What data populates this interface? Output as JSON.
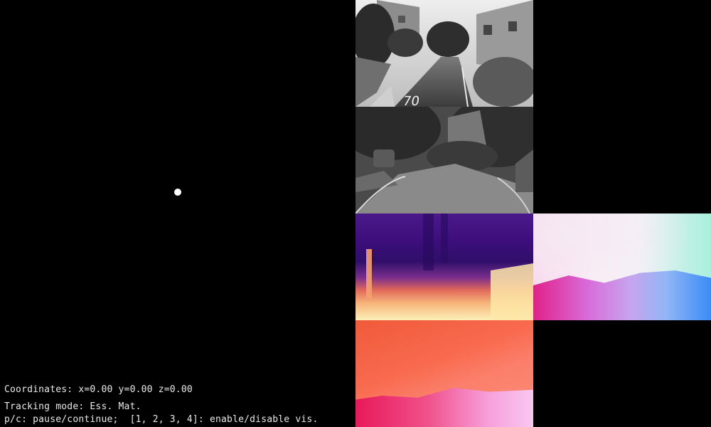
{
  "hud": {
    "coordinates": "Coordinates: x=0.00 y=0.00 z=0.00",
    "tracking_mode": "Tracking mode: Ess. Mat.",
    "controls_help": "p/c: pause/continue;  [1, 2, 3, 4]: enable/disable vis."
  },
  "panels": {
    "camera_top_marking": "70"
  }
}
